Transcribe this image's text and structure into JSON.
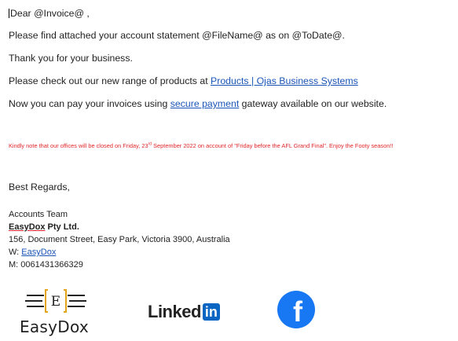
{
  "email": {
    "greeting": "Dear @Invoice@ ,",
    "attached": "Please find attached your account statement @FileName@ as on @ToDate@.",
    "thanks": "Thank you for your business.",
    "products_prefix": "Please check out our new range of products at ",
    "products_link": "Products | Ojas Business Systems",
    "pay_prefix": "Now you can pay your invoices using ",
    "pay_link": "secure payment",
    "pay_suffix": " gateway available on our website.",
    "notice_part1": "Kindly note that our offices will be closed on Friday, 23",
    "notice_sup": "rd",
    "notice_part2": " September 2022 on account of \"Friday before the AFL Grand Final\". Enjoy the Footy season!!",
    "regards": "Best Regards,"
  },
  "signature": {
    "team": "Accounts Team",
    "company_brand": "EasyDox",
    "company_suffix": " Pty Ltd.",
    "address": "156, Document Street, Easy Park, Victoria 3900, Australia",
    "web_label": "W: ",
    "web_link": "EasyDox",
    "mobile": "M: 0061431366329"
  },
  "logos": {
    "easydox_letter": "E",
    "easydox_name": "EasyDox",
    "linkedin_word": "Linked",
    "linkedin_box": "in",
    "facebook_glyph": "f"
  },
  "colors": {
    "link": "#1a55b7",
    "notice": "#e0262a",
    "linkedin": "#0a66c2",
    "facebook": "#1877f2"
  }
}
